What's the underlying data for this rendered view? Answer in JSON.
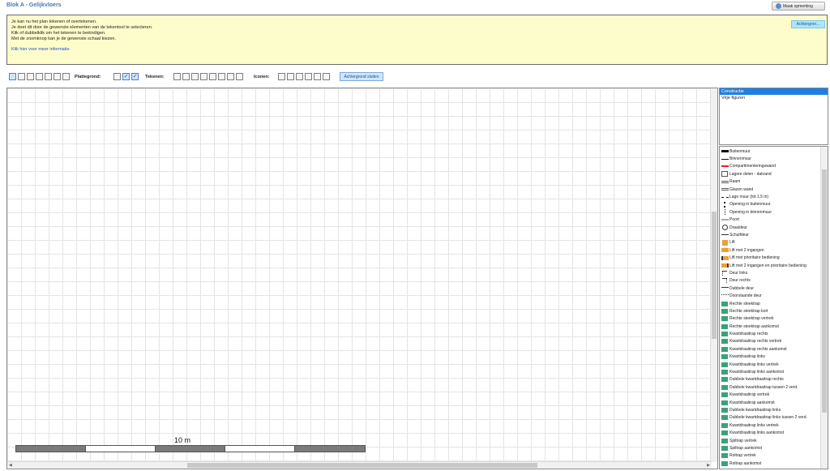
{
  "header": {
    "title": "Blok A - Gelijkvloers",
    "remark_button": "Maak opmerking"
  },
  "info": {
    "lines": [
      "Je kan nu het plan tekenen of overtekenen.",
      "Je doet dit door de gewenste elementen van de tekentool te selecteren.",
      "Klik of dubbelklik om het tekenen te beëindigen.",
      "Met de zoomknop kan je de gewenste schaal kiezen."
    ],
    "more_info_link": "Klik hier voor meer informatie.",
    "background_button": "Achtergron..."
  },
  "toolbar": {
    "plattegrond_label": "Plattegrond:",
    "tekenen_label": "Tekenen:",
    "iconen_label": "Iconen:",
    "close_background_button": "Achtergrond sluiten"
  },
  "canvas": {
    "scale_label": "10 m"
  },
  "layers": {
    "items": [
      "Constructie",
      "Vrije figuren"
    ],
    "selected": "Constructie"
  },
  "palette": {
    "items": [
      {
        "label": "Buitenmuur",
        "icon": "thick-wall-icon"
      },
      {
        "label": "Binnenmuur",
        "icon": "thin-wall-icon"
      },
      {
        "label": "Compartimenteringswand",
        "icon": "red-wall-icon"
      },
      {
        "label": "Lagere delen - dakrand",
        "icon": "roof-edge-icon"
      },
      {
        "label": "Raam",
        "icon": "window-icon"
      },
      {
        "label": "Glazen wand",
        "icon": "glass-wall-icon"
      },
      {
        "label": "Lage muur (tot 1,5 m)",
        "icon": "low-wall-icon"
      },
      {
        "label": "Opening in buitenmuur",
        "icon": "outer-opening-icon"
      },
      {
        "label": "Opening in binnenmuur",
        "icon": "inner-opening-icon"
      },
      {
        "label": "Poort",
        "icon": "gate-icon"
      },
      {
        "label": "Draaideur",
        "icon": "revolving-door-icon"
      },
      {
        "label": "Schuifdeur",
        "icon": "sliding-door-icon"
      },
      {
        "label": "Lift",
        "icon": "elevator-icon"
      },
      {
        "label": "Lift met 2 ingangen",
        "icon": "elevator-2-icon"
      },
      {
        "label": "Lift met prioritaire bediening",
        "icon": "elevator-priority-icon"
      },
      {
        "label": "Lift met 2 ingangen en prioritaire bediening",
        "icon": "elevator-2-priority-icon"
      },
      {
        "label": "Deur links",
        "icon": "door-left-icon"
      },
      {
        "label": "Deur rechts",
        "icon": "door-right-icon"
      },
      {
        "label": "Dubbele deur",
        "icon": "double-door-icon"
      },
      {
        "label": "Doorslaande deur",
        "icon": "swing-door-icon"
      },
      {
        "label": "Rechte steektrap",
        "icon": "straight-stair-icon"
      },
      {
        "label": "Rechte steektrap kort",
        "icon": "straight-stair-short-icon"
      },
      {
        "label": "Rechte steektrap vertrek",
        "icon": "straight-stair-start-icon"
      },
      {
        "label": "Rechte steektrap aankomst",
        "icon": "straight-stair-end-icon"
      },
      {
        "label": "Kwartdraaitrap rechts",
        "icon": "quarter-stair-right-icon"
      },
      {
        "label": "Kwartdraaitrap rechts vertrek",
        "icon": "quarter-stair-right-start-icon"
      },
      {
        "label": "Kwartdraaitrap rechts aankomst",
        "icon": "quarter-stair-right-end-icon"
      },
      {
        "label": "Kwartdraaitrap links",
        "icon": "quarter-stair-left-icon"
      },
      {
        "label": "Kwartdraaitrap links vertrek",
        "icon": "quarter-stair-left-start-icon"
      },
      {
        "label": "Kwartdraaitrap links aankomst",
        "icon": "quarter-stair-left-end-icon"
      },
      {
        "label": "Dubbele kwartdraaitrap rechts",
        "icon": "double-quarter-stair-right-icon"
      },
      {
        "label": "Dubbele kwartdraaitrap tussen 2 verd.",
        "icon": "double-quarter-stair-between-icon"
      },
      {
        "label": "Kwartdraaitrap vertrek",
        "icon": "quarter-stair-start-icon"
      },
      {
        "label": "Kwartdraaitrap aankomst",
        "icon": "quarter-stair-end-icon"
      },
      {
        "label": "Dubbele kwartdraaitrap links",
        "icon": "double-quarter-stair-left-icon"
      },
      {
        "label": "Dubbele kwartdraaitrap links tussen 2 verd.",
        "icon": "double-quarter-stair-left-between-icon"
      },
      {
        "label": "Kwartdraaitrap links vertrek",
        "icon": "quarter-stair-left-start-2-icon"
      },
      {
        "label": "Kwartdraaitrap links aankomst",
        "icon": "quarter-stair-left-end-2-icon"
      },
      {
        "label": "Spiltrap vertrek",
        "icon": "spiral-stair-start-icon"
      },
      {
        "label": "Spiltrap aankomst",
        "icon": "spiral-stair-end-icon"
      },
      {
        "label": "Roltrap vertrek",
        "icon": "escalator-start-icon"
      },
      {
        "label": "Roltrap aankomst",
        "icon": "escalator-end-icon"
      }
    ]
  }
}
